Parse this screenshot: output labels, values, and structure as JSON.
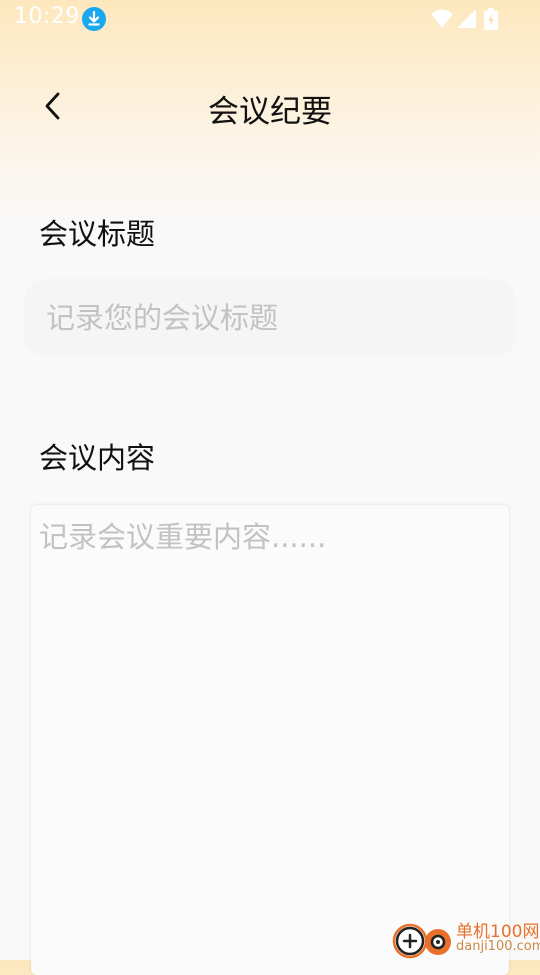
{
  "status_bar": {
    "time": "10:29",
    "icons": [
      "download-notification-icon",
      "wifi-icon",
      "signal-icon",
      "battery-charging-icon"
    ]
  },
  "header": {
    "title": "会议纪要",
    "back_icon": "chevron-left-icon"
  },
  "form": {
    "title_label": "会议标题",
    "title_placeholder": "记录您的会议标题",
    "title_value": "",
    "content_label": "会议内容",
    "content_placeholder": "记录会议重要内容......",
    "content_value": ""
  },
  "watermark": {
    "brand": "单机100网",
    "domain": "danji100.com"
  },
  "colors": {
    "header_gradient_top": "#fde7bd",
    "background": "#f9f9f9",
    "download_badge": "#19a8f0",
    "placeholder": "#c2c2c2",
    "watermark_orange": "#e8702a"
  }
}
